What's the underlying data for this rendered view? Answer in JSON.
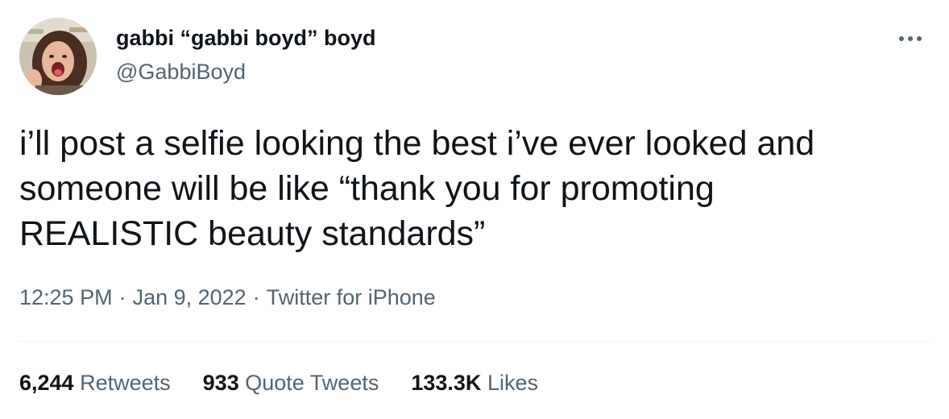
{
  "author": {
    "display_name": "gabbi “gabbi boyd” boyd",
    "handle": "@GabbiBoyd",
    "avatar_icon": "profile-photo"
  },
  "tweet": {
    "text": "i’ll post a selfie looking the best i’ve ever looked and\nsomeone will be like “thank you for promoting\nREALISTIC beauty standards”",
    "time": "12:25 PM",
    "separator": "·",
    "date": "Jan 9, 2022",
    "source": "Twitter for iPhone"
  },
  "stats": {
    "retweets_count": "6,244",
    "retweets_label": "Retweets",
    "quotes_count": "933",
    "quotes_label": "Quote Tweets",
    "likes_count": "133.3K",
    "likes_label": "Likes"
  },
  "colors": {
    "text_primary": "#0f1419",
    "text_secondary": "#536471",
    "divider": "#eff3f4"
  },
  "icons": {
    "more": "more-options-icon"
  }
}
